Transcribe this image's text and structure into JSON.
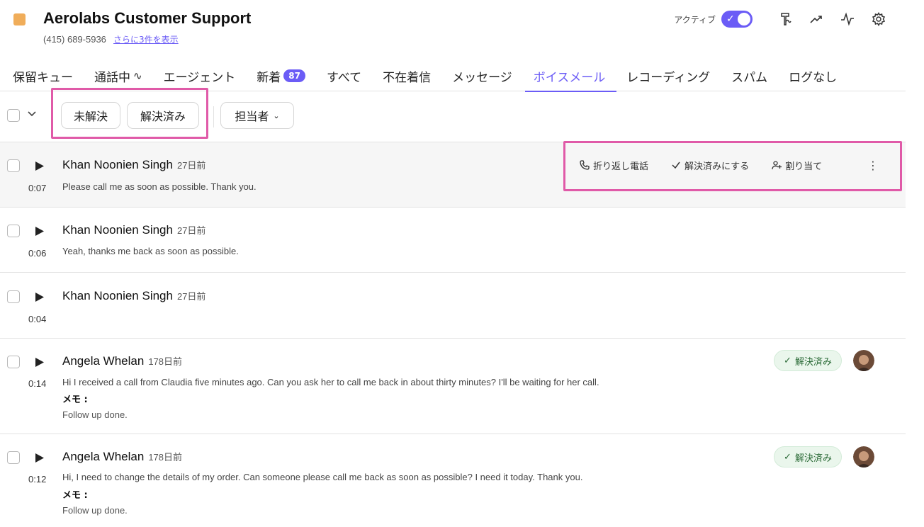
{
  "header": {
    "title": "Aerolabs Customer Support",
    "phone": "(415) 689-5936",
    "show_more": "さらに3件を表示",
    "active_label": "アクティブ",
    "active_on": true,
    "icons": [
      "voicemail-drop-icon",
      "trending-icon",
      "activity-icon",
      "gear-icon"
    ],
    "brand_color": "#f0ad5a",
    "accent_color": "#6b5cf6"
  },
  "tabs": [
    {
      "label": "保留キュー"
    },
    {
      "label": "通話中"
    },
    {
      "label": "エージェント"
    },
    {
      "label": "新着",
      "badge": "87"
    },
    {
      "label": "すべて"
    },
    {
      "label": "不在着信"
    },
    {
      "label": "メッセージ"
    },
    {
      "label": "ボイスメール",
      "active": true
    },
    {
      "label": "レコーディング"
    },
    {
      "label": "スパム"
    },
    {
      "label": "ログなし"
    }
  ],
  "filters": {
    "unresolved": "未解決",
    "resolved": "解決済み",
    "assignee": "担当者"
  },
  "row_actions": {
    "call_back": "折り返し電話",
    "mark_resolved": "解決済みにする",
    "assign": "割り当て"
  },
  "voicemails": [
    {
      "caller": "Khan Noonien Singh",
      "ago": "27日前",
      "duration": "0:07",
      "text": "Please call me as soon as possible. Thank you."
    },
    {
      "caller": "Khan Noonien Singh",
      "ago": "27日前",
      "duration": "0:06",
      "text": "Yeah, thanks me back as soon as possible."
    },
    {
      "caller": "Khan Noonien Singh",
      "ago": "27日前",
      "duration": "0:04",
      "text": ""
    },
    {
      "caller": "Angela Whelan",
      "ago": "178日前",
      "duration": "0:14",
      "text": "Hi I received a call from Claudia five minutes ago. Can you ask her to call me back in about thirty minutes? I'll be waiting for her call.",
      "memo_label": "メモ :",
      "memo": "Follow up done.",
      "status": "解決済み"
    },
    {
      "caller": "Angela Whelan",
      "ago": "178日前",
      "duration": "0:12",
      "text": "Hi, I need to change the details of my order. Can someone please call me back as soon as possible? I need it today. Thank you.",
      "memo_label": "メモ :",
      "memo": "Follow up done.",
      "status": "解決済み"
    }
  ]
}
